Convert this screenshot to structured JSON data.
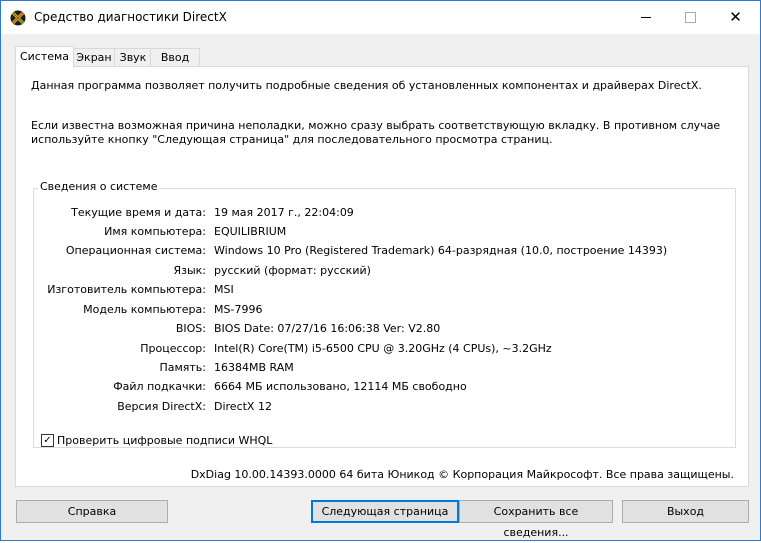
{
  "window": {
    "title": "Средство диагностики DirectX",
    "close_glyph": "✕"
  },
  "tabs": [
    {
      "label": "Система",
      "active": true
    },
    {
      "label": "Экран",
      "active": false
    },
    {
      "label": "Звук",
      "active": false
    },
    {
      "label": "Ввод",
      "active": false
    }
  ],
  "panel": {
    "intro": "Данная программа позволяет получить подробные сведения об установленных компонентах и драйверах DirectX.",
    "hint": "Если известна возможная причина неполадки, можно сразу выбрать соответствующую вкладку. В противном случае используйте кнопку \"Следующая страница\" для последовательного просмотра страниц.",
    "group_title": "Сведения о системе",
    "info": [
      {
        "label": "Текущие время и дата:",
        "value": "19 мая 2017 г., 22:04:09"
      },
      {
        "label": "Имя компьютера:",
        "value": "EQUILIBRIUM"
      },
      {
        "label": "Операционная система:",
        "value": "Windows 10 Pro (Registered Trademark) 64-разрядная (10.0, построение 14393)"
      },
      {
        "label": "Язык:",
        "value": "русский (формат: русский)"
      },
      {
        "label": "Изготовитель компьютера:",
        "value": "MSI"
      },
      {
        "label": "Модель компьютера:",
        "value": "MS-7996"
      },
      {
        "label": "BIOS:",
        "value": "BIOS Date: 07/27/16 16:06:38 Ver: V2.80"
      },
      {
        "label": "Процессор:",
        "value": "Intel(R) Core(TM) i5-6500 CPU @ 3.20GHz (4 CPUs), ~3.2GHz"
      },
      {
        "label": "Память:",
        "value": "16384MB RAM"
      },
      {
        "label": "Файл подкачки:",
        "value": "6664 МБ использовано, 12114 МБ свободно"
      },
      {
        "label": "Версия DirectX:",
        "value": "DirectX 12"
      }
    ],
    "whql_label": "Проверить цифровые подписи WHQL",
    "whql_checked": true,
    "check_glyph": "✓",
    "footer": "DxDiag 10.00.14393.0000 64 бита Юникод © Корпорация Майкрософт. Все права защищены."
  },
  "buttons": {
    "help": "Справка",
    "next": "Следующая страница",
    "save": "Сохранить все сведения...",
    "exit": "Выход"
  },
  "colors": {
    "accent": "#0078d7",
    "window_border": "#2b78d6"
  }
}
